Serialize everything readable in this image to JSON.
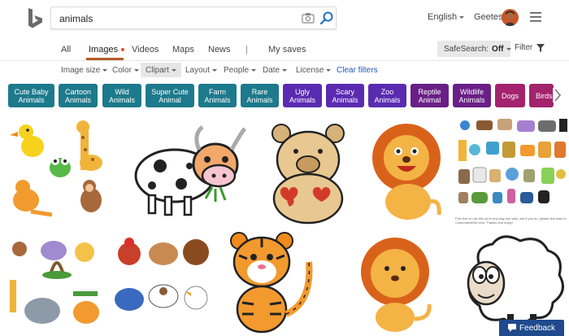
{
  "header": {
    "search_query": "animals",
    "language": "English",
    "user_name": "Geetesh"
  },
  "tabs": {
    "all": "All",
    "images": "Images",
    "videos": "Videos",
    "maps": "Maps",
    "news": "News",
    "separator": "|",
    "my_saves": "My saves"
  },
  "safesearch": {
    "label": "SafeSearch:",
    "value": "Off"
  },
  "filter_label": "Filter",
  "filters": {
    "image_size": "Image size",
    "color": "Color",
    "clipart": "Clipart",
    "layout": "Layout",
    "people": "People",
    "date": "Date",
    "license": "License",
    "clear": "Clear filters"
  },
  "pills": {
    "cute_baby": {
      "line1": "Cute Baby",
      "line2": "Animals",
      "color": "#1d7a8c"
    },
    "cartoon": {
      "line1": "Cartoon",
      "line2": "Animals",
      "color": "#1d7a8c"
    },
    "wild": {
      "line1": "Wild",
      "line2": "Animals",
      "color": "#1d7a8c"
    },
    "super_cute": {
      "line1": "Super Cute",
      "line2": "Animal",
      "color": "#1d7a8c"
    },
    "farm": {
      "line1": "Farm",
      "line2": "Animals",
      "color": "#1d7a8c"
    },
    "rare": {
      "line1": "Rare",
      "line2": "Animals",
      "color": "#1d7a8c"
    },
    "ugly": {
      "line1": "Ugly",
      "line2": "Animals",
      "color": "#5a2bb0"
    },
    "scary": {
      "line1": "Scary",
      "line2": "Animals",
      "color": "#5a2bb0"
    },
    "zoo": {
      "line1": "Zoo",
      "line2": "Animals",
      "color": "#5a2bb0"
    },
    "reptile": {
      "line1": "Reptile",
      "line2": "Animal",
      "color": "#6a1f86"
    },
    "wildlife": {
      "line1": "Wildlife",
      "line2": "Animals",
      "color": "#6a1f86"
    },
    "dogs": {
      "line1": "Dogs",
      "line2": "",
      "color": "#a3236e"
    },
    "birds": {
      "line1": "Birds",
      "line2": "",
      "color": "#a3236e"
    }
  },
  "image_caption": "Feel free to use this art in any way you wish, but if you do, please link back to CustomizedGirl.com. Thanks and enjoy!",
  "feedback_label": "Feedback",
  "icons": [
    "bing-logo",
    "camera-icon",
    "search-icon",
    "menu-icon",
    "filter-icon",
    "chevron-right-icon",
    "caret-down-icon"
  ],
  "colors": {
    "accent": "#b65b24",
    "link": "#1a5ab6",
    "teal": "#1d7a8c",
    "purple": "#5a2bb0"
  }
}
